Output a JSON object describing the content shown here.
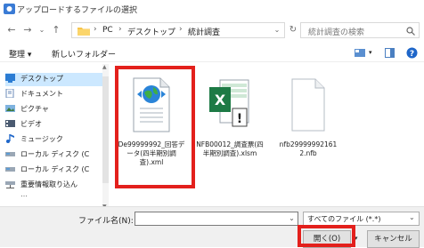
{
  "window": {
    "title": "アップロードするファイルの選択"
  },
  "address": {
    "crumbs": [
      "PC",
      "デスクトップ",
      "統計調査"
    ],
    "search_placeholder": "統計調査の検索"
  },
  "commandbar": {
    "organize": "整理 ▾",
    "new_folder": "新しいフォルダー"
  },
  "navpane": {
    "items": [
      {
        "label": "デスクトップ",
        "icon": "desktop-folder-icon",
        "selected": true
      },
      {
        "label": "ドキュメント",
        "icon": "documents-folder-icon",
        "selected": false
      },
      {
        "label": "ピクチャ",
        "icon": "pictures-folder-icon",
        "selected": false
      },
      {
        "label": "ビデオ",
        "icon": "videos-folder-icon",
        "selected": false
      },
      {
        "label": "ミュージック",
        "icon": "music-folder-icon",
        "selected": false
      },
      {
        "label": "ローカル ディスク (C",
        "icon": "drive-icon",
        "selected": false
      },
      {
        "label": "ローカル ディスク (C",
        "icon": "drive-icon",
        "selected": false
      },
      {
        "label": "重要情報取り込ん",
        "icon": "network-drive-icon",
        "selected": false
      }
    ]
  },
  "files": [
    {
      "name": "De99999992_回答データ(四半期別調査).xml",
      "icon": "xml-file-icon"
    },
    {
      "name": "NFB00012_調査票(四半期別調査).xlsm",
      "icon": "excel-macro-file-icon"
    },
    {
      "name": "nfb29999992161 2.nfb",
      "icon": "blank-file-icon"
    }
  ],
  "bottom": {
    "filename_label": "ファイル名(N):",
    "filename_value": "",
    "filetype_value": "すべてのファイル (*.*)",
    "open_label": "開く(O)",
    "cancel_label": "キャンセル"
  },
  "colors": {
    "highlight": "#e3201c",
    "selection": "#cce8ff",
    "folder": "#f8c54b"
  }
}
